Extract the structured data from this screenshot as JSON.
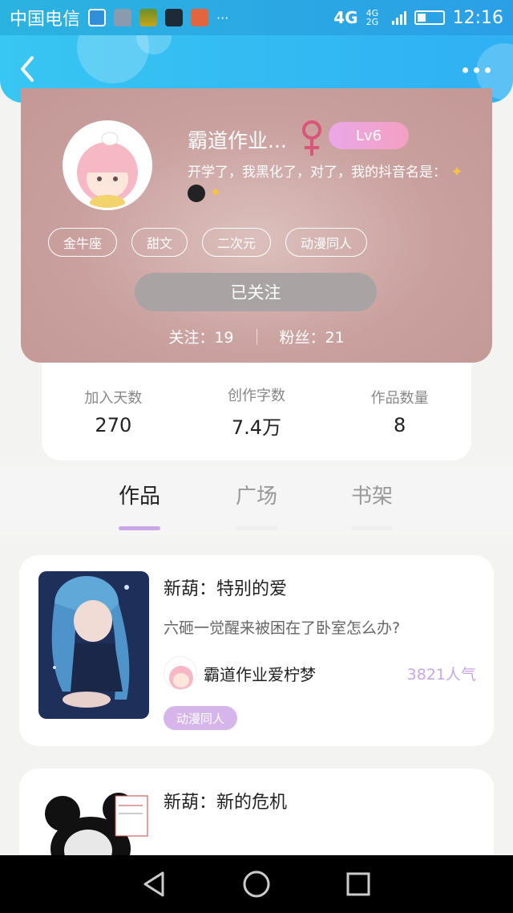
{
  "status_bar": {
    "carrier": "中国电信",
    "network": "4G",
    "network_small": "4G 2G",
    "time": "12:16",
    "more": "···"
  },
  "header": {
    "back_icon": "chevron-left-icon",
    "more_icon": "more-horizontal-icon"
  },
  "profile": {
    "nickname": "霸道作业...",
    "gender_icon": "female-icon",
    "gender_color": "#d9557a",
    "level": "Lv6",
    "bio": "开学了，我黑化了，对了，我的抖音名是：",
    "tags": [
      "金牛座",
      "甜文",
      "二次元",
      "动漫同人"
    ],
    "follow_button": "已关注",
    "following_label": "关注：19",
    "followers_label": "粉丝：21"
  },
  "stats": [
    {
      "label": "加入天数",
      "value": "270"
    },
    {
      "label": "创作字数",
      "value": "7.4万"
    },
    {
      "label": "作品数量",
      "value": "8"
    }
  ],
  "tabs": [
    {
      "label": "作品",
      "active": true
    },
    {
      "label": "广场",
      "active": false
    },
    {
      "label": "书架",
      "active": false
    }
  ],
  "works": [
    {
      "title": "新葫：特别的爱",
      "description": "六砸一觉醒来被困在了卧室怎么办?",
      "author": "霸道作业爱柠梦",
      "popularity": "3821人气",
      "tag": "动漫同人"
    },
    {
      "title": "新葫：新的危机"
    }
  ],
  "nav": {
    "back_icon": "triangle-back-icon",
    "home_icon": "circle-home-icon",
    "recents_icon": "square-recents-icon"
  },
  "colors": {
    "accent": "#c9a6e8",
    "header": "#38c6f2",
    "level_badge": "#e9a8e8"
  }
}
